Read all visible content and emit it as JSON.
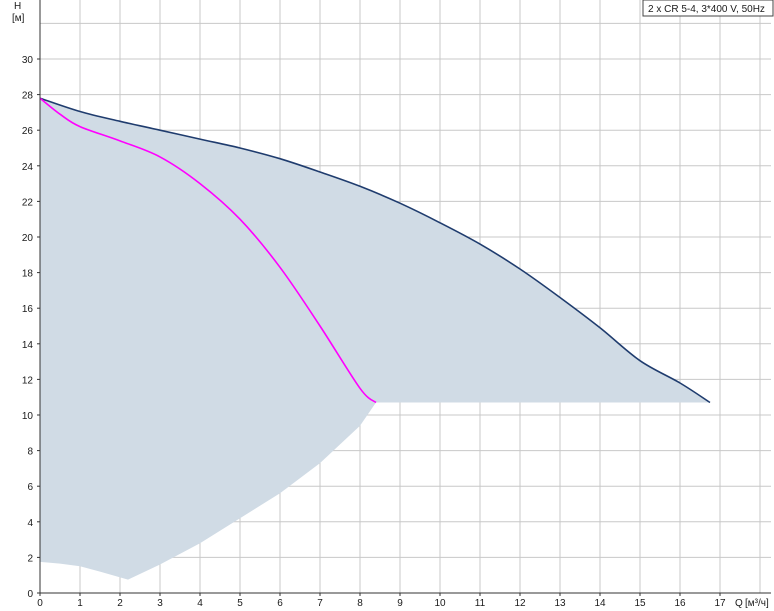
{
  "chart_data": {
    "type": "area",
    "legend_title": "2 x CR 5-4, 3*400 V, 50Hz",
    "y_axis": {
      "label": "H",
      "unit": "[м]",
      "ticks": [
        0,
        2,
        4,
        6,
        8,
        10,
        12,
        14,
        16,
        18,
        20,
        22,
        24,
        26,
        28,
        30
      ],
      "range": [
        0,
        33
      ]
    },
    "x_axis": {
      "label": "Q",
      "unit": "[м³/ч]",
      "ticks": [
        0,
        1,
        2,
        3,
        4,
        5,
        6,
        7,
        8,
        9,
        10,
        11,
        12,
        13,
        14,
        15,
        16,
        17
      ],
      "range": [
        0,
        18.4
      ]
    },
    "grid": true,
    "colors": {
      "area": "#d0dbe5",
      "max_curve": "#1f3c6e",
      "duty_curve": "#ff00ff",
      "grid": "#c8c8c8"
    },
    "operating_area": {
      "x": [
        0,
        1,
        2,
        3,
        4,
        5,
        6,
        7,
        8,
        9,
        10,
        11,
        12,
        13,
        14,
        15,
        16,
        16.75,
        8.4,
        8.0,
        7.0,
        6.0,
        5.0,
        4.0,
        3.0,
        2.2,
        1.5,
        1.0,
        0.5,
        0
      ],
      "y": [
        27.8,
        27.05,
        26.5,
        26.0,
        25.5,
        25.0,
        24.4,
        23.65,
        22.85,
        21.9,
        20.8,
        19.6,
        18.2,
        16.6,
        14.9,
        13.05,
        11.8,
        10.7,
        10.7,
        9.4,
        7.3,
        5.6,
        4.2,
        2.8,
        1.6,
        0.75,
        1.2,
        1.5,
        1.65,
        1.75
      ]
    },
    "series": [
      {
        "name": "",
        "style": "max",
        "x": [
          0,
          1,
          2,
          3,
          4,
          5,
          6,
          7,
          8,
          9,
          10,
          11,
          12,
          13,
          14,
          15,
          16,
          16.75
        ],
        "y": [
          27.8,
          27.05,
          26.5,
          26.0,
          25.5,
          25.0,
          24.4,
          23.65,
          22.85,
          21.9,
          20.8,
          19.6,
          18.2,
          16.6,
          14.9,
          13.05,
          11.8,
          10.7
        ]
      },
      {
        "name": "",
        "style": "duty",
        "x": [
          0,
          0.5,
          1,
          2,
          3,
          4,
          5,
          6,
          7,
          8,
          8.4
        ],
        "y": [
          27.8,
          26.9,
          26.2,
          25.4,
          24.5,
          23.0,
          21.0,
          18.3,
          15.0,
          11.5,
          10.7
        ]
      }
    ]
  }
}
